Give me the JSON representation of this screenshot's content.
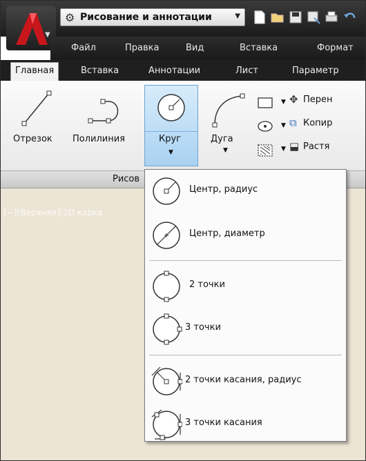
{
  "quick_access": {
    "workspace_label": "Рисование и аннотации"
  },
  "menu_bar": {
    "items": [
      "Файл",
      "Правка",
      "Вид",
      "Вставка",
      "Формат"
    ]
  },
  "ribbon_tabs": {
    "items": [
      "Главная",
      "Вставка",
      "Аннотации",
      "Лист",
      "Параметр"
    ]
  },
  "ribbon": {
    "line_label": "Отрезок",
    "polyline_label": "Полилиния",
    "circle_label": "Круг",
    "arc_label": "Дуга",
    "panel_title": "Рисов",
    "modify_commands": [
      "Перен",
      "Копир",
      "Растя"
    ]
  },
  "viewport": {
    "label": "[−][Верхняя][2D карка"
  },
  "circle_menu": {
    "items": [
      {
        "label": "Центр, радиус",
        "icon": "circle-center-radius-icon"
      },
      {
        "label": "Центр, диаметр",
        "icon": "circle-center-diameter-icon"
      },
      {
        "label": "2 точки",
        "icon": "circle-2-point-icon"
      },
      {
        "label": "3 точки",
        "icon": "circle-3-point-icon"
      },
      {
        "label": "2 точки касания, радиус",
        "icon": "circle-tan-tan-radius-icon"
      },
      {
        "label": "3 точки касания",
        "icon": "circle-tan-tan-tan-icon"
      }
    ]
  },
  "colors": {
    "title_bar": "#1c1c1c",
    "ribbon_bg": "#f2f2f2",
    "highlight_blue": "#a9d2f2",
    "viewport_bg": "#ece4d4",
    "logo_red": "#c8161d"
  }
}
